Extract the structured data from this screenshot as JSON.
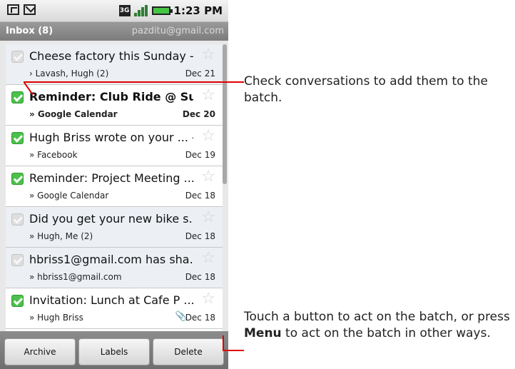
{
  "status_bar": {
    "network_label": "3G",
    "time": "1:23 PM",
    "icons": [
      "sim-icon",
      "mail-icon",
      "network-3g-icon",
      "signal-icon",
      "battery-icon"
    ]
  },
  "header": {
    "title": "Inbox (8)",
    "account": "pazditu@gmail.com"
  },
  "conversations": [
    {
      "subject": "Cheese factory this Sunday - ...",
      "sender": "› Lavash, Hugh (2)",
      "date": "Dec 21",
      "checked": false,
      "unread": false
    },
    {
      "subject": "Reminder: Club Ride @ Su...",
      "sender": "» Google Calendar",
      "date": "Dec 20",
      "checked": true,
      "unread": true
    },
    {
      "subject": "Hugh Briss wrote on your ... -...",
      "sender": "» Facebook",
      "date": "Dec 19",
      "checked": true,
      "unread": false
    },
    {
      "subject": "Reminder: Project Meeting ...",
      "sender": "» Google Calendar",
      "date": "Dec 18",
      "checked": true,
      "unread": false
    },
    {
      "subject": "Did you get your new bike s...",
      "sender": "» Hugh, Me (2)",
      "date": "Dec 18",
      "checked": false,
      "unread": false
    },
    {
      "subject": "hbriss1@gmail.com has sha...",
      "sender": "» hbriss1@gmail.com",
      "date": "Dec 18",
      "checked": false,
      "unread": false
    },
    {
      "subject": "Invitation: Lunch at Cafe P ...",
      "sender": "» Hugh Briss",
      "date": "Dec 18",
      "checked": true,
      "unread": false,
      "attachment": true
    }
  ],
  "actions": {
    "archive": "Archive",
    "labels": "Labels",
    "delete": "Delete"
  },
  "annotations": {
    "top_callout": "Check conversations to add them to the batch.",
    "bottom_callout_before": "Touch a button to act on the batch, or press ",
    "bottom_callout_bold": "Menu",
    "bottom_callout_after": " to act on the batch in other ways."
  },
  "colors": {
    "callout_line": "#e00000",
    "checkbox_checked": "#4cc04c",
    "title_bar": "#8a8a8a"
  }
}
